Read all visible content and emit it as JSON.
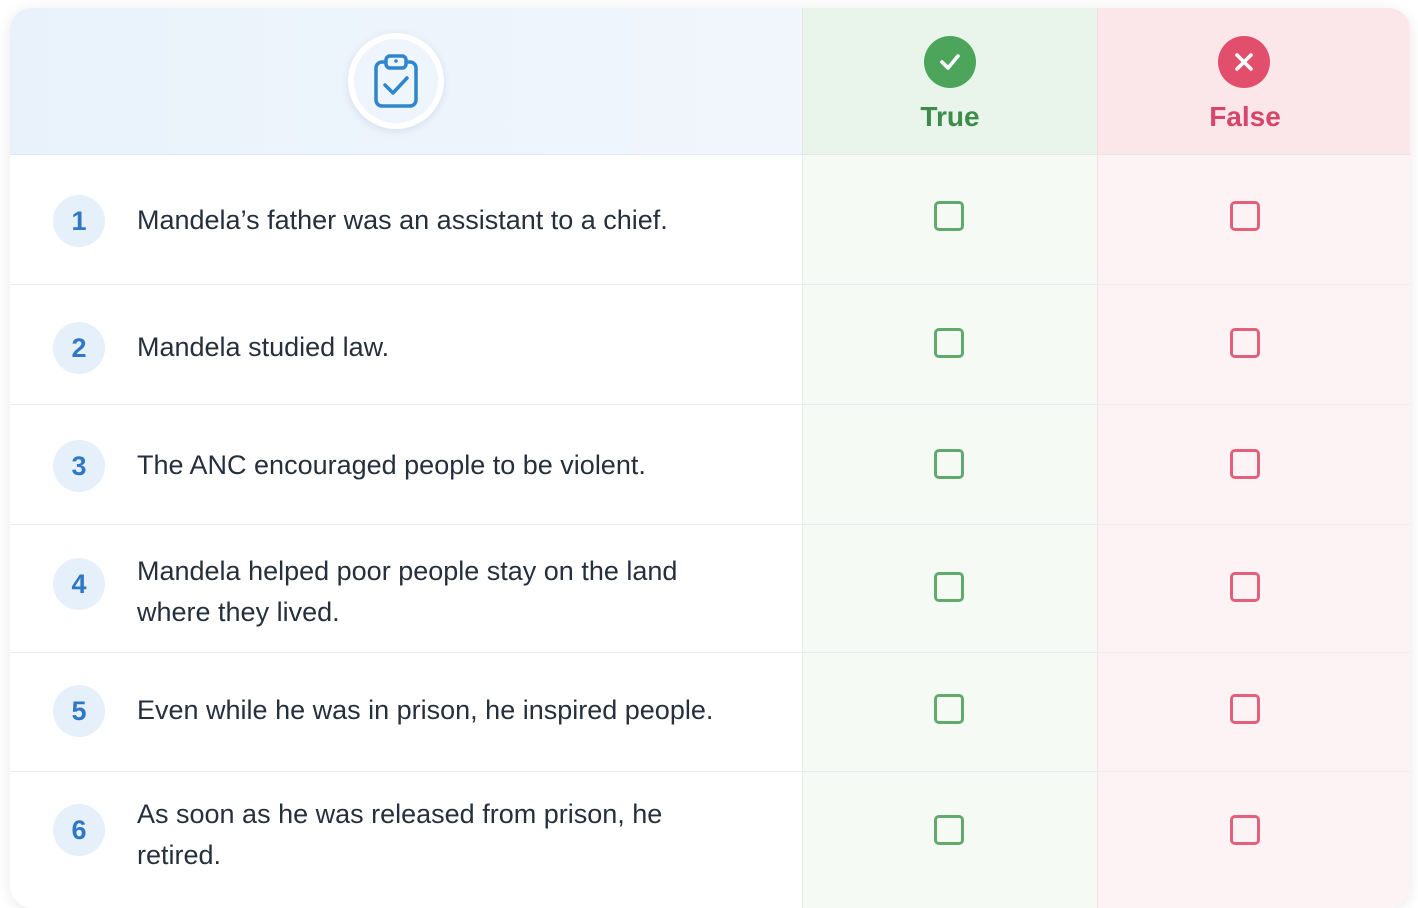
{
  "header": {
    "clipboard_icon": "clipboard-check-icon",
    "true_icon": "check-circle-icon",
    "true_label": "True",
    "false_icon": "x-circle-icon",
    "false_label": "False"
  },
  "colors": {
    "true_accent": "#4ca55a",
    "false_accent": "#e24f6c",
    "number_blue": "#2f78c3"
  },
  "questions": [
    {
      "number": "1",
      "text": "Mandela’s father was an assistant to a chief."
    },
    {
      "number": "2",
      "text": "Mandela studied law."
    },
    {
      "number": "3",
      "text": "The ANC encouraged people to be violent."
    },
    {
      "number": "4",
      "text": "Mandela helped poor people stay on the land where they lived."
    },
    {
      "number": "5",
      "text": "Even while he was in prison, he inspired people."
    },
    {
      "number": "6",
      "text": "As soon as he was released from prison, he retired."
    }
  ]
}
